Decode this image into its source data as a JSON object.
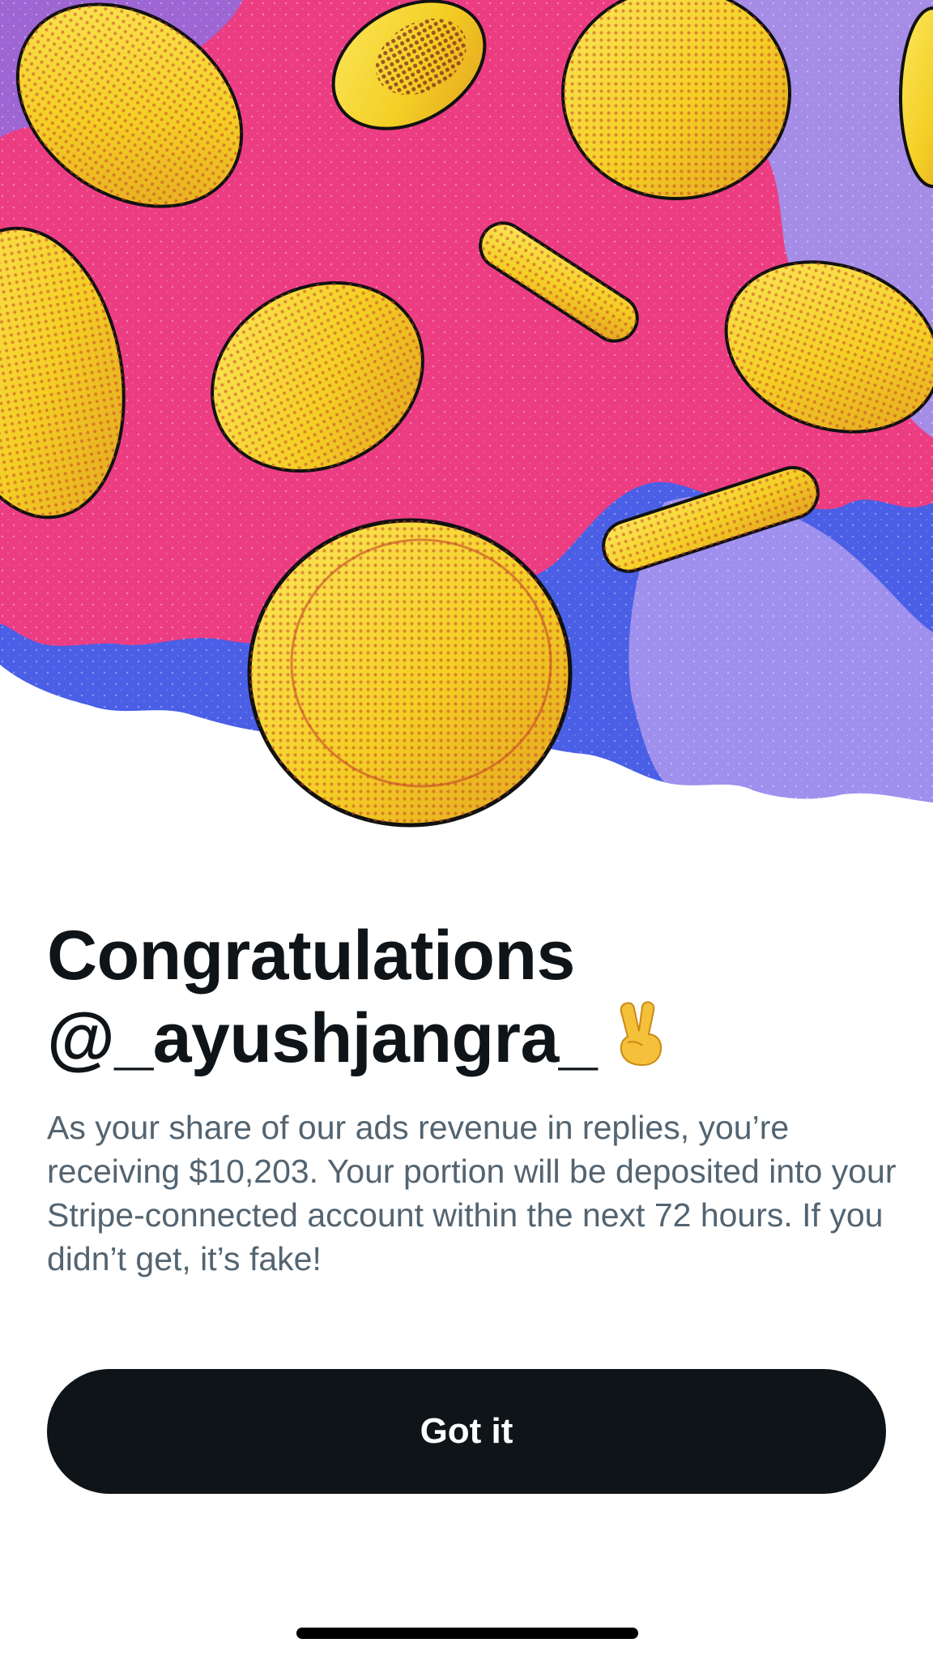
{
  "hero": {
    "illustration": "falling-gold-coins",
    "colors": {
      "pink": "#ec3d83",
      "blue": "#4a5fe6",
      "lavender": "#a58ce6",
      "coin_gold": "#f6d12b",
      "coin_shadow": "#b63a2a"
    }
  },
  "title": {
    "line1": "Congratulations",
    "line2": "@_ayushjangra_",
    "emoji": "✌️"
  },
  "body": {
    "text": "As your share of our ads revenue in replies, you’re receiving $10,203. Your portion will be deposited into your Stripe-connected account within the next 72 hours. If you didn’t get, it’s fake!"
  },
  "button": {
    "label": "Got it",
    "color": "#0f1419"
  }
}
